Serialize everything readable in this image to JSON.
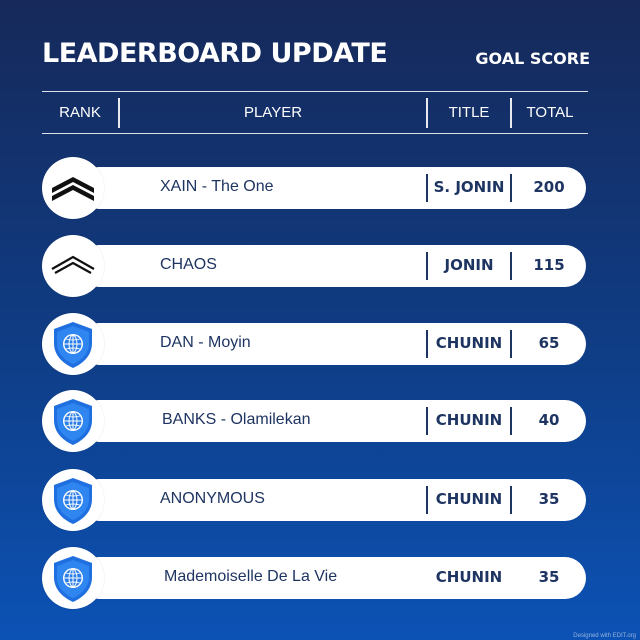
{
  "header": {
    "title": "LEADERBOARD UPDATE",
    "subtitle": "GOAL SCORE"
  },
  "columns": {
    "rank": "RANK",
    "player": "PLAYER",
    "title": "TITLE",
    "total": "TOTAL"
  },
  "rows": [
    {
      "badge": "double-chevron-icon",
      "player": "XAIN - The One",
      "title": "S. JONIN",
      "total": "200"
    },
    {
      "badge": "single-chevron-icon",
      "player": "CHAOS",
      "title": "JONIN",
      "total": "115"
    },
    {
      "badge": "globe-shield-icon",
      "player": "DAN - Moyin",
      "title": "CHUNIN",
      "total": "65"
    },
    {
      "badge": "globe-shield-icon",
      "player": "BANKS - Olamilekan",
      "title": "CHUNIN",
      "total": "40"
    },
    {
      "badge": "globe-shield-icon",
      "player": "ANONYMOUS",
      "title": "CHUNIN",
      "total": "35"
    },
    {
      "badge": "globe-shield-icon",
      "player": "Mademoiselle De La Vie",
      "title": "CHUNIN",
      "total": "35"
    }
  ],
  "colors": {
    "background_top": "#16295a",
    "background_bottom": "#0c52b5",
    "text_dark": "#1e3461",
    "shield_blue": "#1f6fe0"
  },
  "credit": "Designed with EDIT.org"
}
